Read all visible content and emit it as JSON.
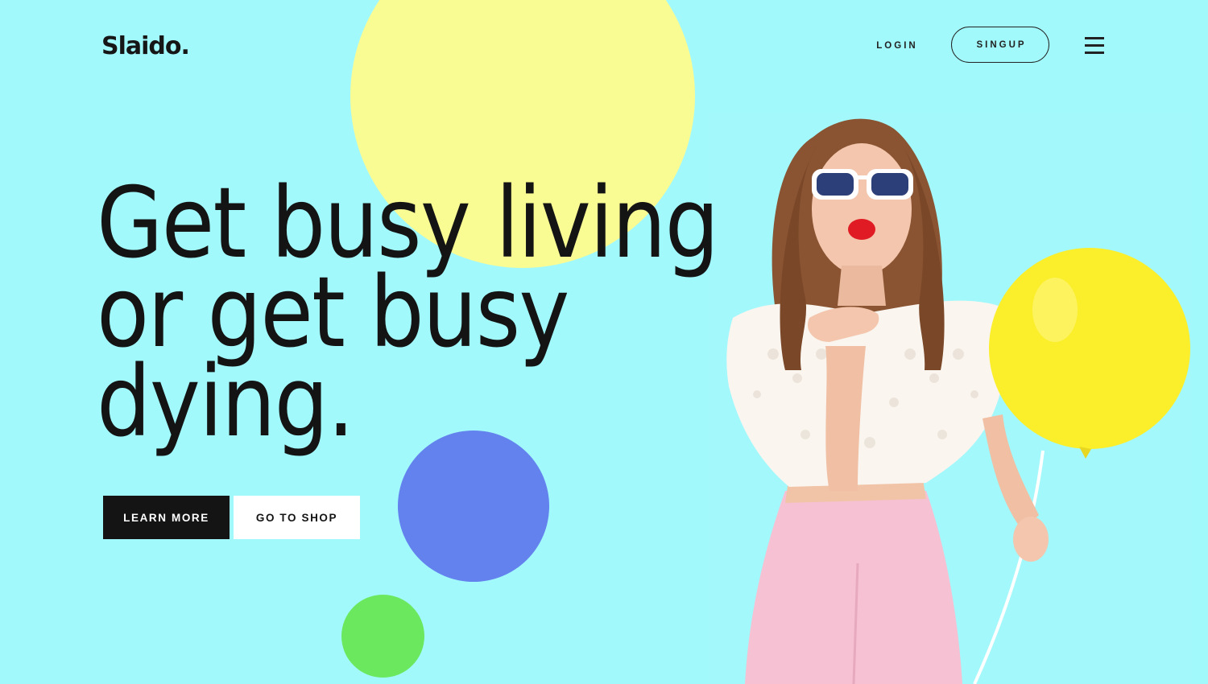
{
  "header": {
    "logo": "Slaido.",
    "login_label": "LOGIN",
    "signup_label": "SINGUP",
    "menu_icon": "hamburger-menu-icon"
  },
  "hero": {
    "headline_lines": [
      "Get busy living",
      "or get busy",
      "dying."
    ],
    "primary_button": "LEARN MORE",
    "secondary_button": "GO TO SHOP"
  },
  "colors": {
    "background": "#a2f9fc",
    "yellow_circle": "#f9fb93",
    "blue_circle": "#6382ee",
    "green_circle": "#6be85e",
    "balloon": "#fbee2b",
    "text_dark": "#141414"
  }
}
